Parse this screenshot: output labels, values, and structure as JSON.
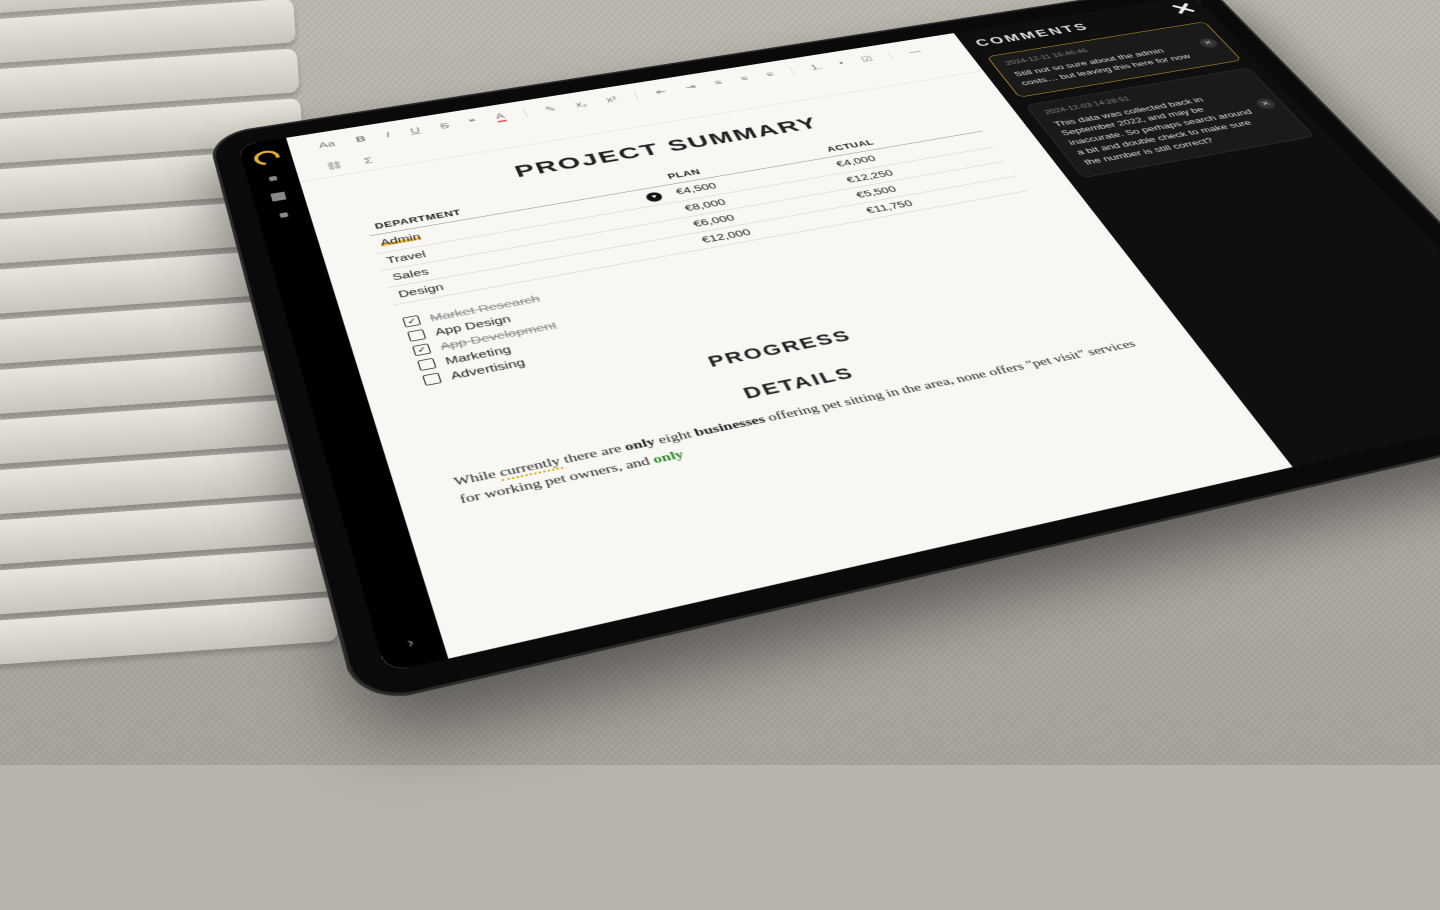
{
  "doc": {
    "title": "PROJECT SUMMARY",
    "sections": {
      "progress": "PROGRESS",
      "details": "DETAILS"
    }
  },
  "toolbar": {
    "font": "Aa",
    "bold": "B",
    "italic": "I",
    "underline": "U",
    "strike": "S",
    "quote": "❝",
    "color": "A",
    "pen": "✎",
    "sub": "x₂",
    "sup": "x²",
    "outdent": "⇤",
    "indent": "⇥",
    "alignL": "≡",
    "alignC": "≡",
    "alignR": "≡",
    "olist": "1.",
    "ulist": "•",
    "check": "☑",
    "hr": "—",
    "link": "⛓",
    "sigma": "Σ"
  },
  "table": {
    "headers": {
      "dept": "DEPARTMENT",
      "plan": "PLAN",
      "actual": "ACTUAL"
    },
    "rows": [
      {
        "dept": "Admin",
        "plan": "€4,500",
        "actual": "€4,000",
        "highlighted": true
      },
      {
        "dept": "Travel",
        "plan": "€8,000",
        "actual": "€12,250"
      },
      {
        "dept": "Sales",
        "plan": "€6,000",
        "actual": "€5,500"
      },
      {
        "dept": "Design",
        "plan": "€12,000",
        "actual": "€11,750"
      }
    ]
  },
  "tasks": [
    {
      "label": "Market Research",
      "done": true
    },
    {
      "label": "App Design",
      "done": false
    },
    {
      "label": "App Development",
      "done": true
    },
    {
      "label": "Marketing",
      "done": false
    },
    {
      "label": "Advertising",
      "done": false
    }
  ],
  "details": {
    "p1a": "While ",
    "p1_currently": "currently",
    "p1b": " there are ",
    "p1_only": "only",
    "p1c": " eight ",
    "p1_businesses": "businesses",
    "p1d": " offering pet sitting in the area, none offers \"pet visit\" services for working pet owners, and ",
    "p1_only2": "only"
  },
  "comments": {
    "title": "COMMENTS",
    "items": [
      {
        "ts": "2024-12-11 16:46:46",
        "text": "Still not so sure about the admin costs… but leaving this here for now",
        "selected": true
      },
      {
        "ts": "2024-12-03 14:28:51",
        "text": "This data was collected back in September 2022, and may be inaccurate. So perhaps search around a bit and double check to make sure the number is still correct?",
        "selected": false
      }
    ]
  }
}
